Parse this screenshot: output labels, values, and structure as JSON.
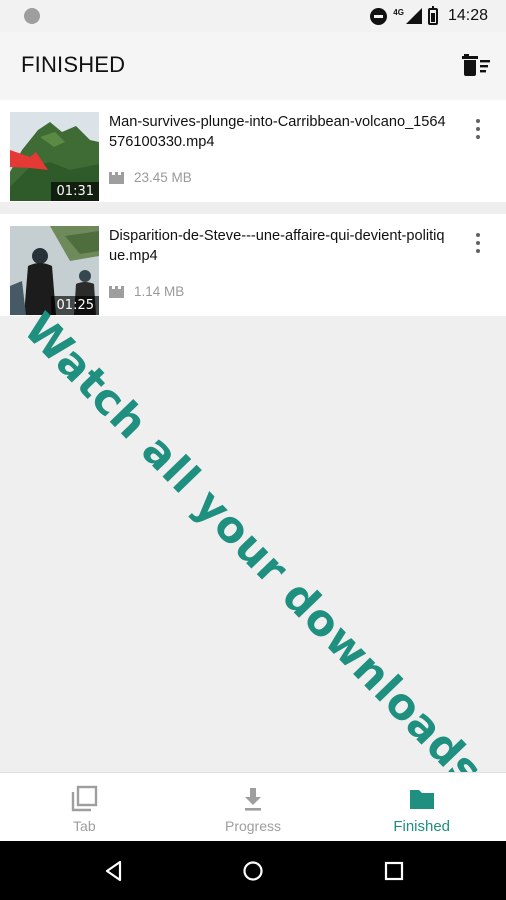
{
  "status_bar": {
    "network": "4G",
    "time": "14:28"
  },
  "app_bar": {
    "title": "FINISHED",
    "delete_icon": "delete-sweep-icon"
  },
  "downloads": [
    {
      "filename": "Man-survives-plunge-into-Carribbean-volcano_1564576100330.mp4",
      "duration": "01:31",
      "size": "23.45 MB"
    },
    {
      "filename": "Disparition-de-Steve---une-affaire-qui-devient-politique.mp4",
      "duration": "01:25",
      "size": "1.14 MB"
    }
  ],
  "promo": {
    "text": "Watch all your downloads",
    "color": "#1f8f80"
  },
  "bottom_nav": {
    "items": [
      {
        "label": "Tab",
        "icon": "tabs-icon"
      },
      {
        "label": "Progress",
        "icon": "download-icon"
      },
      {
        "label": "Finished",
        "icon": "folder-icon"
      }
    ],
    "active_index": 2,
    "active_color": "#1f8f80"
  },
  "system_nav": {
    "icons": [
      "back-icon",
      "home-icon",
      "recents-icon"
    ]
  }
}
